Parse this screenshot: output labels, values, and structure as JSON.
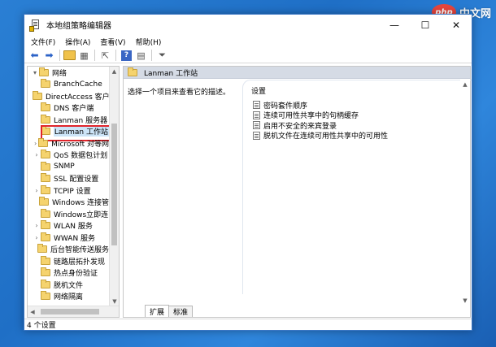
{
  "watermark": {
    "logo": "php",
    "text": "中文网"
  },
  "window": {
    "title": "本地组策略编辑器",
    "controls": {
      "minimize": "—",
      "maximize": "☐",
      "close": "✕"
    }
  },
  "menu": [
    "文件(F)",
    "操作(A)",
    "查看(V)",
    "帮助(H)"
  ],
  "toolbar": {
    "icons": [
      "back-arrow-icon",
      "forward-arrow-icon",
      "up-folder-icon",
      "show-tree-icon",
      "export-list-icon",
      "help-icon",
      "properties-icon",
      "filter-icon"
    ],
    "help_glyph": "?"
  },
  "tree": {
    "items": [
      {
        "label": "网络",
        "expander": "▾",
        "level": 0
      },
      {
        "label": "BranchCache",
        "expander": "",
        "level": 1
      },
      {
        "label": "DirectAccess 客户",
        "expander": "",
        "level": 1
      },
      {
        "label": "DNS 客户端",
        "expander": "",
        "level": 1
      },
      {
        "label": "Lanman 服务器",
        "expander": "",
        "level": 1
      },
      {
        "label": "Lanman 工作站",
        "expander": "",
        "level": 1,
        "selected": true
      },
      {
        "label": "Microsoft 对等网",
        "expander": "›",
        "level": 1
      },
      {
        "label": "QoS 数据包计划",
        "expander": "›",
        "level": 1
      },
      {
        "label": "SNMP",
        "expander": "",
        "level": 1
      },
      {
        "label": "SSL 配置设置",
        "expander": "",
        "level": 1
      },
      {
        "label": "TCPIP 设置",
        "expander": "›",
        "level": 1
      },
      {
        "label": "Windows 连接管",
        "expander": "",
        "level": 1
      },
      {
        "label": "Windows立即连",
        "expander": "",
        "level": 1
      },
      {
        "label": "WLAN 服务",
        "expander": "›",
        "level": 1
      },
      {
        "label": "WWAN 服务",
        "expander": "›",
        "level": 1
      },
      {
        "label": "后台智能传送服务",
        "expander": "",
        "level": 1
      },
      {
        "label": "链路层拓扑发现",
        "expander": "",
        "level": 1
      },
      {
        "label": "热点身份验证",
        "expander": "",
        "level": 1
      },
      {
        "label": "脱机文件",
        "expander": "",
        "level": 1
      },
      {
        "label": "网络隔离",
        "expander": "",
        "level": 1
      }
    ]
  },
  "right_pane": {
    "header": "Lanman 工作站",
    "description": "选择一个项目来查看它的描述。",
    "settings_header": "设置",
    "settings": [
      "密码套件顺序",
      "连续可用性共享中的句柄缓存",
      "启用不安全的来宾登录",
      "脱机文件在连续可用性共享中的可用性"
    ]
  },
  "tabs": [
    {
      "label": "扩展",
      "active": true
    },
    {
      "label": "标准",
      "active": false
    }
  ],
  "status": "4 个设置",
  "colors": {
    "selection_outline": "#e0252b",
    "pane_header": "#d5dbe5",
    "desktop": "#1f6fc6"
  }
}
